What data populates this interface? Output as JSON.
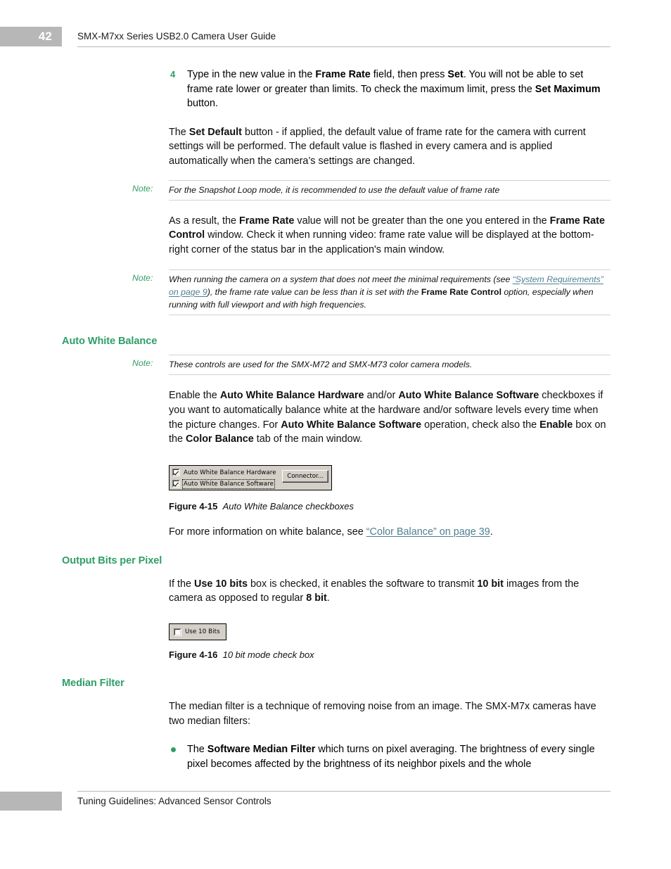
{
  "header": {
    "page_number": "42",
    "title": "SMX-M7xx Series USB2.0 Camera User Guide"
  },
  "footer": {
    "text": "Tuning Guidelines:  Advanced Sensor Controls"
  },
  "colors": {
    "heading_green": "#2f9e68",
    "link_blue": "#4d7f92",
    "page_block_gray": "#b7b7b7",
    "rule_gray": "#d2d2d2"
  },
  "step4": {
    "number": "4",
    "text_1": "Type in the new value in the ",
    "bold_1": "Frame Rate",
    "text_2": " field, then press ",
    "bold_2": "Set",
    "text_3": ". You will not be able to set frame rate lower or greater than limits. To check the maximum limit, press the ",
    "bold_3": "Set Maximum",
    "text_4": " button."
  },
  "para_set_default": {
    "text_1": "The ",
    "bold_1": "Set Default",
    "text_2": " button - if applied, the default value of frame rate for the camera with current settings will be performed. The default value is flashed in every camera and is applied automatically when the camera’s settings are changed."
  },
  "note_snapshot": {
    "label": "Note:",
    "text": "For the Snapshot Loop mode, it is recommended to use the default value of frame rate"
  },
  "para_as_result": {
    "text_1": "As a result, the ",
    "bold_1": "Frame Rate",
    "text_2": " value will not be greater than the one you entered in the ",
    "bold_2": "Frame Rate Control",
    "text_3": " window. Check it when running video: frame rate value will be displayed at the bottom-right corner of the status bar in the application's main window."
  },
  "note_requirements": {
    "label": "Note:",
    "text_1": "When running the camera on a system that does not meet the minimal requirements (see ",
    "link": "“System Requirements” on page 9",
    "text_2": "), the frame rate value can be less than it is set with the ",
    "bold_1": "Frame Rate Control",
    "text_3": " option, especially when running with full viewport and with high frequencies."
  },
  "section_awb": {
    "heading": "Auto White Balance",
    "note": {
      "label": "Note:",
      "text": "These controls are used for the SMX-M72 and SMX-M73 color camera models."
    },
    "para": {
      "text_1": "Enable the ",
      "bold_1": "Auto White Balance Hardware",
      "text_2": " and/or ",
      "bold_2": "Auto White Balance Software",
      "text_3": " checkboxes if you want to automatically balance white at the hardware and/or software levels every time when the picture changes. For ",
      "bold_3": "Auto White Balance Software",
      "text_4": " operation, check also the ",
      "bold_4": "Enable",
      "text_5": " box on the ",
      "bold_5": "Color Balance",
      "text_6": " tab of the main window."
    },
    "figure": {
      "checkbox_hardware_label": "Auto White Balance Hardware",
      "checkbox_hardware_checked": "checked",
      "checkbox_software_label": "Auto White Balance Software",
      "checkbox_software_checked": "checked",
      "button_label": "Connector...",
      "caption_number": "Figure 4-15",
      "caption_title": "Auto White Balance checkboxes"
    },
    "more_info": {
      "text_1": "For more information on white balance, see ",
      "link": "“Color Balance” on page 39",
      "text_2": "."
    }
  },
  "section_output_bits": {
    "heading": "Output Bits per Pixel",
    "para": {
      "text_1": "If the ",
      "bold_1": "Use 10 bits",
      "text_2": " box is checked, it enables the software to transmit ",
      "bold_2": "10 bit",
      "text_3": " images from the camera as opposed to regular ",
      "bold_3": "8 bit",
      "text_4": "."
    },
    "figure": {
      "checkbox_label": "Use 10 Bits",
      "checkbox_checked": "unchecked",
      "caption_number": "Figure 4-16",
      "caption_title": "10 bit mode check box"
    }
  },
  "section_median": {
    "heading": "Median Filter",
    "para": {
      "text_1": "The median filter is a technique of removing noise from an image. The SMX-M7x cameras have two median filters:"
    },
    "bullet": {
      "text_1": "The ",
      "bold_1": "Software Median Filter",
      "text_2": " which turns on pixel averaging. The brightness of every single pixel becomes affected by the brightness of its neighbor pixels and the whole"
    }
  }
}
